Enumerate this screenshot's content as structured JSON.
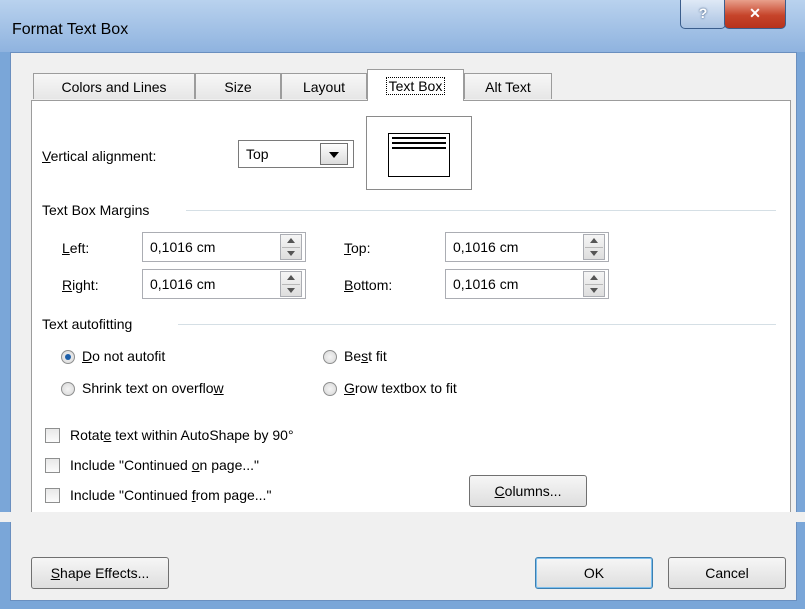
{
  "window": {
    "title": "Format Text Box",
    "help_glyph": "?",
    "close_glyph": "✕"
  },
  "tabs": [
    {
      "label": "Colors and Lines",
      "active": false
    },
    {
      "label": "Size",
      "active": false
    },
    {
      "label": "Layout",
      "active": false
    },
    {
      "label": "Text Box",
      "active": true
    },
    {
      "label": "Alt Text",
      "active": false
    }
  ],
  "vertical_alignment": {
    "label_first": "V",
    "label_rest": "ertical alignment:",
    "value": "Top"
  },
  "margins": {
    "section_title": "Text Box Margins",
    "left": {
      "label_first": "L",
      "label_rest": "eft:",
      "value": "0,1016 cm"
    },
    "right": {
      "label_first": "R",
      "label_rest": "ight:",
      "value": "0,1016 cm"
    },
    "top": {
      "label_first": "T",
      "label_rest": "op:",
      "value": "0,1016 cm"
    },
    "bottom": {
      "label_first": "B",
      "label_rest": "ottom:",
      "value": "0,1016 cm"
    }
  },
  "autofit": {
    "section_title": "Text autofitting",
    "do_not_autofit": {
      "pre": "",
      "key": "D",
      "post": "o not autofit",
      "selected": true
    },
    "best_fit": {
      "pre": "Be",
      "key": "s",
      "post": "t fit",
      "selected": false
    },
    "shrink": {
      "pre": "Shrink text on overflo",
      "key": "w",
      "post": "",
      "selected": false
    },
    "grow": {
      "pre": "",
      "key": "G",
      "post": "row textbox to fit",
      "selected": false
    }
  },
  "options": {
    "rotate": {
      "pre": "Rotat",
      "key": "e",
      "post": " text within AutoShape by 90°",
      "checked": false
    },
    "continued_on": {
      "pre": "Include \"Continued ",
      "key": "o",
      "post": "n page...\"",
      "checked": false
    },
    "continued_from": {
      "pre": "Include \"Continued ",
      "key": "f",
      "post": "rom page...\"",
      "checked": false
    }
  },
  "buttons": {
    "columns": {
      "key": "C",
      "post": "olumns..."
    },
    "shape_effects": {
      "key": "S",
      "post": "hape Effects..."
    },
    "ok": "OK",
    "cancel": "Cancel"
  }
}
